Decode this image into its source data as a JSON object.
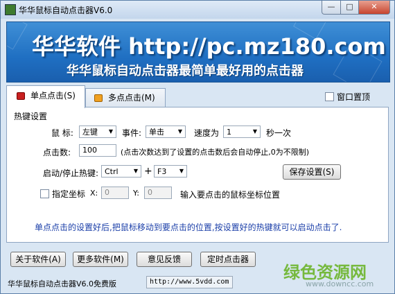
{
  "window": {
    "title": "华华鼠标自动点击器V6.0",
    "controls": {
      "minimize": "—",
      "maximize": "□",
      "close": "✕"
    }
  },
  "banner": {
    "headline": "华华软件 http://pc.mz180.com",
    "tagline": "华华鼠标自动点击器最简单最好用的点击器"
  },
  "tabs": [
    {
      "label": "单点点击(S)",
      "active": true,
      "icon": "red-square-icon"
    },
    {
      "label": "多点点击(M)",
      "active": false,
      "icon": "orange-square-icon"
    }
  ],
  "topmost": {
    "label": "窗口置顶",
    "checked": false
  },
  "hotkey_group": {
    "title": "热键设置"
  },
  "mouse": {
    "label": "鼠 标:",
    "value": "左键"
  },
  "event": {
    "label": "事件:",
    "value": "单击"
  },
  "speed": {
    "label": "速度为",
    "value": "1",
    "unit": "秒一次"
  },
  "clicks": {
    "label": "点击数:",
    "value": "100",
    "note": "(点击次数达到了设置的点击数后会自动停止,0为不限制)"
  },
  "hotkey": {
    "label": "启动/停止热键:",
    "modifier": "Ctrl",
    "plus": "+",
    "key": "F3"
  },
  "save_button": "保存设置(S)",
  "coords": {
    "checkbox_label": "指定坐标",
    "checked": false,
    "x_label": "X:",
    "x_value": "0",
    "y_label": "Y:",
    "y_value": "0",
    "hint": "输入要点击的鼠标坐标位置"
  },
  "hint_text": "单点点击的设置好后,把鼠标移动到要点击的位置,按设置好的热键就可以启动点击了.",
  "bottom_buttons": [
    {
      "label": "关于软件(A)"
    },
    {
      "label": "更多软件(M)"
    },
    {
      "label": "意见反馈"
    },
    {
      "label": "定时点击器"
    }
  ],
  "status": {
    "left": "华华鼠标自动点击器V6.0免费版",
    "url": "http://www.5vdd.com"
  },
  "watermark": {
    "logo": "绿色资源网",
    "url": "www.downcc.com"
  },
  "colors": {
    "banner": "#1f6fc2",
    "hint": "#1a3ea8",
    "window_bg": "#d9e6f3",
    "watermark": "#6cb52b"
  }
}
